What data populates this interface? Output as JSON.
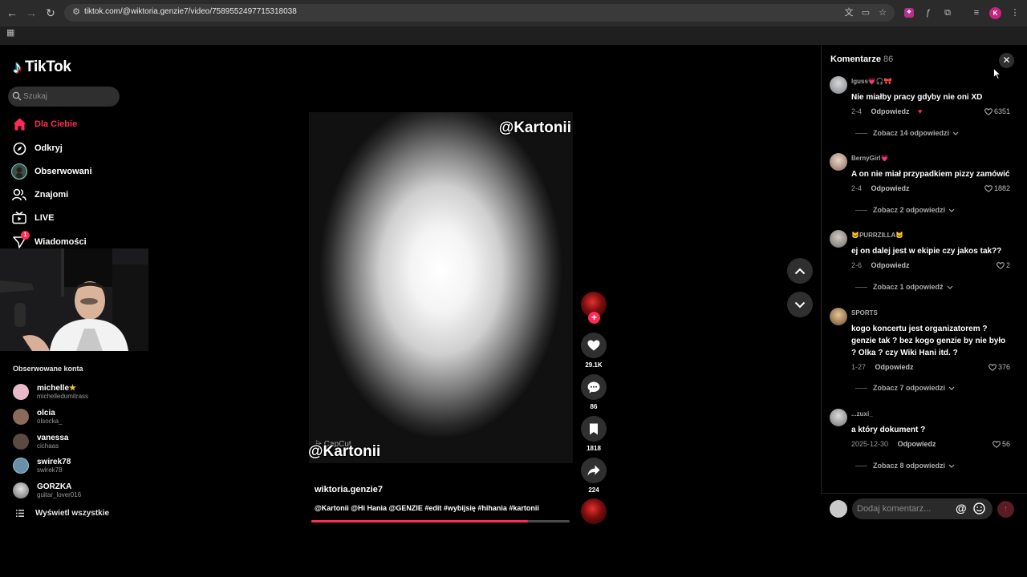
{
  "browser": {
    "url": "tiktok.com/@wiktoria.genzie7/video/7589552497715318038",
    "profile_initial": "K"
  },
  "sidebar": {
    "logo": "TikTok",
    "search_placeholder": "Szukaj",
    "nav": [
      {
        "label": "Dla Ciebie",
        "icon": "home-icon",
        "active": true
      },
      {
        "label": "Odkryj",
        "icon": "compass-icon"
      },
      {
        "label": "Obserwowani",
        "icon": "following-avatar-icon"
      },
      {
        "label": "Znajomi",
        "icon": "friends-icon"
      },
      {
        "label": "LIVE",
        "icon": "live-tv-icon"
      },
      {
        "label": "Wiadomości",
        "icon": "messages-icon",
        "badge": "1"
      }
    ],
    "following_title": "Obserwowane konta",
    "accounts": [
      {
        "name": "michelle",
        "handle": "michelledumitrass",
        "badge": "★",
        "color": "#e8b9c8"
      },
      {
        "name": "olcia",
        "handle": "olsocka_",
        "color": "#8a6a5a"
      },
      {
        "name": "vanessa",
        "handle": "cichaas",
        "color": "#5a4a40"
      },
      {
        "name": "swirek78",
        "handle": "swirek78",
        "color": "#6b8fa8"
      },
      {
        "name": "GORZKA",
        "handle": "guitar_lover016",
        "color": "#d0d0d0"
      }
    ],
    "show_all": "Wyświetl wszystkie"
  },
  "video": {
    "overlay_top": "@Kartonii",
    "overlay_bottom": "@Kartonii",
    "watermark": "CapCut",
    "author": "wiktoria.genzie7",
    "caption": "@Kartonii @Hi Hania @GENZIE #edit #wybijsię #hihania #kartonii",
    "progress": 0.84
  },
  "actions": {
    "likes": "29.1K",
    "comments": "86",
    "saves": "1818",
    "shares": "224"
  },
  "comments_panel": {
    "title": "Komentarze",
    "count": "86",
    "input_placeholder": "Dodaj komentarz...",
    "comments": [
      {
        "user": "lguss💗🎧🎀",
        "text": "Nie miałby pracy gdyby nie oni XD",
        "date": "2-4",
        "reply": "Odpowiedz",
        "likes": "6351",
        "more": "Zobacz 14 odpowiedzi",
        "avatar": "#9aa0a8"
      },
      {
        "user": "BernyGirl💗",
        "text": "A on nie miał przypadkiem pizzy zamówić",
        "date": "2-4",
        "reply": "Odpowiedz",
        "likes": "1882",
        "more": "Zobacz 2 odpowiedzi",
        "avatar": "#c8b0a0"
      },
      {
        "user": "🐱PURRZILLA🐱",
        "text": "ej on dalej jest w ekipie czy jakos tak??",
        "date": "2-6",
        "reply": "Odpowiedz",
        "likes": "2",
        "more": "Zobacz 1 odpowiedź",
        "avatar": "#a8a39a"
      },
      {
        "user": "SPORTS",
        "text": "kogo koncertu jest organizatorem ? genzie tak ? bez kogo genzie by nie było ? Olka ? czy Wiki Hani itd. ?",
        "date": "1-27",
        "reply": "Odpowiedz",
        "likes": "376",
        "more": "Zobacz 7 odpowiedzi",
        "avatar": "#c79a6a"
      },
      {
        "user": "...zuxi_",
        "text": "a który dokument ?",
        "date": "2025-12-30",
        "reply": "Odpowiedz",
        "likes": "56",
        "more": "Zobacz 8 odpowiedzi",
        "avatar": "#b5b5b5"
      }
    ]
  },
  "colors": {
    "accent": "#fe2c55",
    "panel_bg": "#000000",
    "button_bg": "#2f2f2f"
  }
}
